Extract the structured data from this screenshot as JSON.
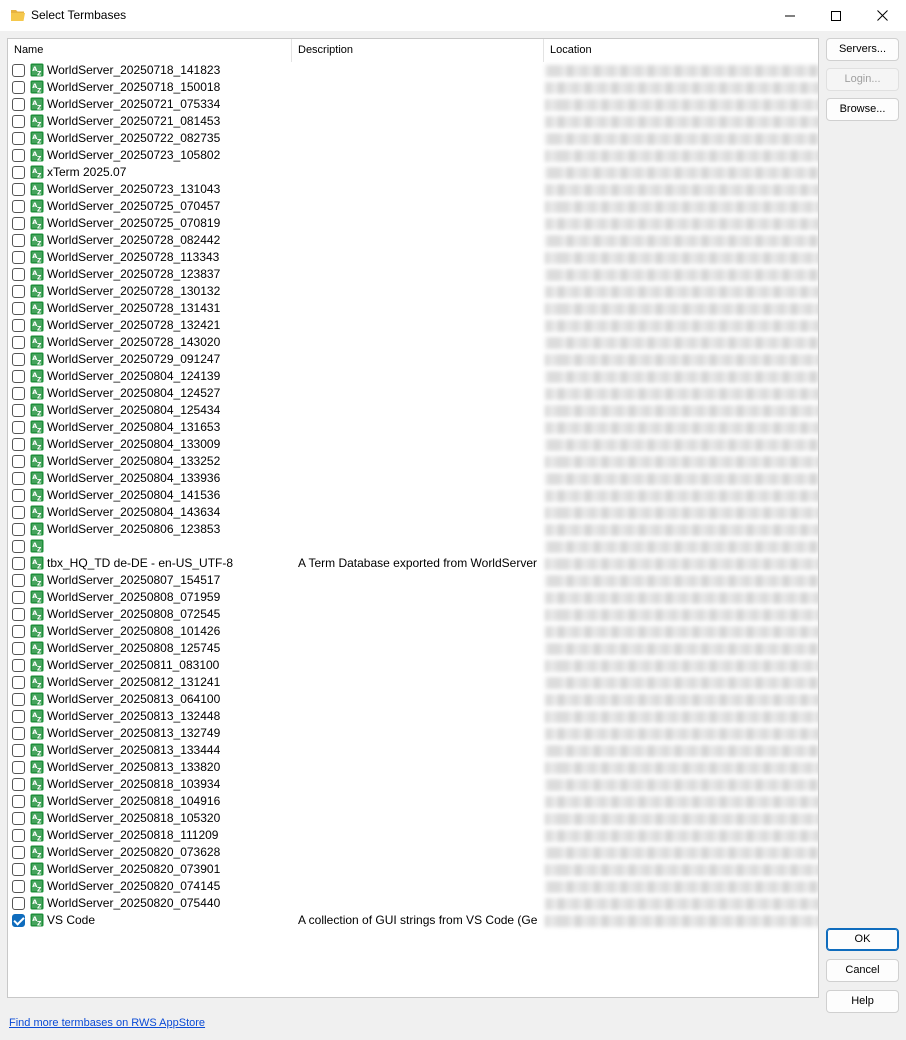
{
  "window": {
    "title": "Select Termbases",
    "folder_icon": "folder-open-icon"
  },
  "columns": {
    "name": "Name",
    "description": "Description",
    "location": "Location"
  },
  "rows": [
    {
      "name": "WorldServer_20250718_141823",
      "description": "",
      "checked": false
    },
    {
      "name": "WorldServer_20250718_150018",
      "description": "",
      "checked": false
    },
    {
      "name": "WorldServer_20250721_075334",
      "description": "",
      "checked": false
    },
    {
      "name": "WorldServer_20250721_081453",
      "description": "",
      "checked": false
    },
    {
      "name": "WorldServer_20250722_082735",
      "description": "",
      "checked": false
    },
    {
      "name": "WorldServer_20250723_105802",
      "description": "",
      "checked": false
    },
    {
      "name": "xTerm 2025.07",
      "description": "",
      "checked": false
    },
    {
      "name": "WorldServer_20250723_131043",
      "description": "",
      "checked": false
    },
    {
      "name": "WorldServer_20250725_070457",
      "description": "",
      "checked": false
    },
    {
      "name": "WorldServer_20250725_070819",
      "description": "",
      "checked": false
    },
    {
      "name": "WorldServer_20250728_082442",
      "description": "",
      "checked": false
    },
    {
      "name": "WorldServer_20250728_113343",
      "description": "",
      "checked": false
    },
    {
      "name": "WorldServer_20250728_123837",
      "description": "",
      "checked": false
    },
    {
      "name": "WorldServer_20250728_130132",
      "description": "",
      "checked": false
    },
    {
      "name": "WorldServer_20250728_131431",
      "description": "",
      "checked": false
    },
    {
      "name": "WorldServer_20250728_132421",
      "description": "",
      "checked": false
    },
    {
      "name": "WorldServer_20250728_143020",
      "description": "",
      "checked": false
    },
    {
      "name": "WorldServer_20250729_091247",
      "description": "",
      "checked": false
    },
    {
      "name": "WorldServer_20250804_124139",
      "description": "",
      "checked": false
    },
    {
      "name": "WorldServer_20250804_124527",
      "description": "",
      "checked": false
    },
    {
      "name": "WorldServer_20250804_125434",
      "description": "",
      "checked": false
    },
    {
      "name": "WorldServer_20250804_131653",
      "description": "",
      "checked": false
    },
    {
      "name": "WorldServer_20250804_133009",
      "description": "",
      "checked": false
    },
    {
      "name": "WorldServer_20250804_133252",
      "description": "",
      "checked": false
    },
    {
      "name": "WorldServer_20250804_133936",
      "description": "",
      "checked": false
    },
    {
      "name": "WorldServer_20250804_141536",
      "description": "",
      "checked": false
    },
    {
      "name": "WorldServer_20250804_143634",
      "description": "",
      "checked": false
    },
    {
      "name": "WorldServer_20250806_123853",
      "description": "",
      "checked": false
    },
    {
      "name": "",
      "description": "",
      "checked": false
    },
    {
      "name": "tbx_HQ_TD de-DE - en-US_UTF-8",
      "description": "A Term Database exported from WorldServer",
      "checked": false
    },
    {
      "name": "WorldServer_20250807_154517",
      "description": "",
      "checked": false
    },
    {
      "name": "WorldServer_20250808_071959",
      "description": "",
      "checked": false
    },
    {
      "name": "WorldServer_20250808_072545",
      "description": "",
      "checked": false
    },
    {
      "name": "WorldServer_20250808_101426",
      "description": "",
      "checked": false
    },
    {
      "name": "WorldServer_20250808_125745",
      "description": "",
      "checked": false
    },
    {
      "name": "WorldServer_20250811_083100",
      "description": "",
      "checked": false
    },
    {
      "name": "WorldServer_20250812_131241",
      "description": "",
      "checked": false
    },
    {
      "name": "WorldServer_20250813_064100",
      "description": "",
      "checked": false
    },
    {
      "name": "WorldServer_20250813_132448",
      "description": "",
      "checked": false
    },
    {
      "name": "WorldServer_20250813_132749",
      "description": "",
      "checked": false
    },
    {
      "name": "WorldServer_20250813_133444",
      "description": "",
      "checked": false
    },
    {
      "name": "WorldServer_20250813_133820",
      "description": "",
      "checked": false
    },
    {
      "name": "WorldServer_20250818_103934",
      "description": "",
      "checked": false
    },
    {
      "name": "WorldServer_20250818_104916",
      "description": "",
      "checked": false
    },
    {
      "name": "WorldServer_20250818_105320",
      "description": "",
      "checked": false
    },
    {
      "name": "WorldServer_20250818_111209",
      "description": "",
      "checked": false
    },
    {
      "name": "WorldServer_20250820_073628",
      "description": "",
      "checked": false
    },
    {
      "name": "WorldServer_20250820_073901",
      "description": "",
      "checked": false
    },
    {
      "name": "WorldServer_20250820_074145",
      "description": "",
      "checked": false
    },
    {
      "name": "WorldServer_20250820_075440",
      "description": "",
      "checked": false
    },
    {
      "name": "VS Code",
      "description": "A collection of GUI strings from VS Code (Germa...",
      "checked": true
    }
  ],
  "buttons": {
    "servers": "Servers...",
    "login": "Login...",
    "browse": "Browse...",
    "ok": "OK",
    "cancel": "Cancel",
    "help": "Help"
  },
  "footer": {
    "appstore_link": "Find more termbases on RWS AppStore"
  },
  "colors": {
    "accent": "#0f6cbd",
    "termbase_icon": "#1e8f3a",
    "link": "#0b4bd6"
  }
}
